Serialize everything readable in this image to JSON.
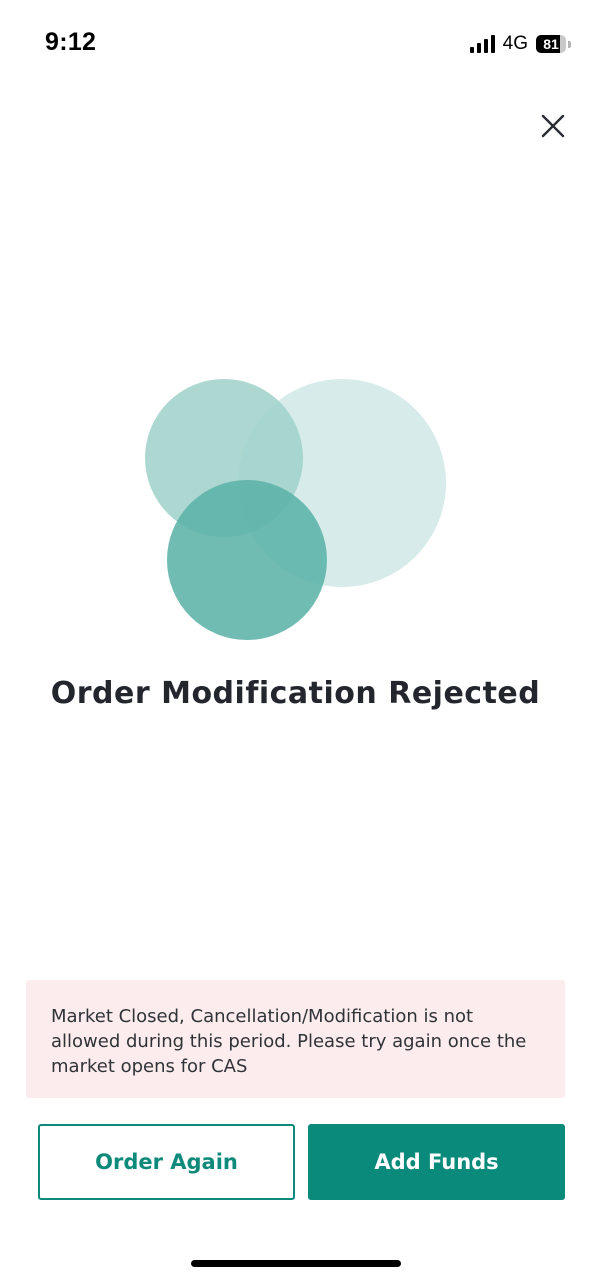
{
  "status_bar": {
    "time": "9:12",
    "network": "4G",
    "battery_level": "81",
    "battery_fraction": 0.81
  },
  "icons": {
    "close": "close-icon",
    "signal": "cellular-signal-icon",
    "battery": "battery-icon"
  },
  "illustration": {
    "circle_light": "#d7ecea",
    "circle_mid": "#9fd1ca",
    "circle_dark": "#5cb3a8",
    "overlap": "#4fa69a"
  },
  "screen": {
    "title": "Order Modification Rejected",
    "message": "Market Closed, Cancellation/Modification is not allowed during this period. Please try again once the market opens for CAS"
  },
  "actions": {
    "order_again_label": "Order Again",
    "add_funds_label": "Add Funds"
  },
  "colors": {
    "accent": "#0a8a7b",
    "title_text": "#23262d",
    "message_background": "#fdeced"
  }
}
